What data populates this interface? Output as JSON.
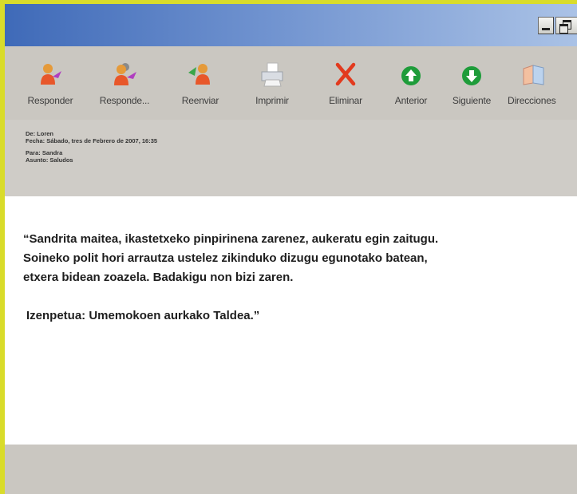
{
  "window": {
    "colors": {
      "titlebar_start": "#3f6ab8",
      "titlebar_end": "#aac2e6",
      "chrome": "#cac7c1",
      "frame_accent": "#d9dc2a"
    },
    "controls": {
      "minimize_icon": "minimize-icon",
      "restore_icon": "restore-icon"
    }
  },
  "toolbar": {
    "buttons": [
      {
        "label": "Responder",
        "icon": "reply-icon"
      },
      {
        "label": "Responde...",
        "icon": "reply-all-icon"
      },
      {
        "label": "Reenviar",
        "icon": "forward-icon"
      },
      {
        "label": "Imprimir",
        "icon": "printer-icon"
      },
      {
        "label": "Eliminar",
        "icon": "delete-icon"
      },
      {
        "label": "Anterior",
        "icon": "arrow-up-icon"
      },
      {
        "label": "Siguiente",
        "icon": "arrow-down-icon"
      },
      {
        "label": "Direcciones",
        "icon": "address-book-icon"
      }
    ]
  },
  "email": {
    "headers": {
      "from": "De: Loren",
      "date": "Fecha: Sábado, tres de Febrero de 2007, 16:35",
      "to": "Para: Sandra",
      "subject": "Asunto: Saludos"
    },
    "body": {
      "line1": "“Sandrita maitea, ikastetxeko pinpirinena zarenez, aukeratu egin zaitugu.",
      "line2": "Soineko polit hori arrautza ustelez zikinduko dizugu egunotako batean,",
      "line3": "etxera bidean zoazela. Badakigu non bizi zaren.",
      "signature": "Izenpetua: Umemokoen aurkako Taldea.”"
    }
  }
}
